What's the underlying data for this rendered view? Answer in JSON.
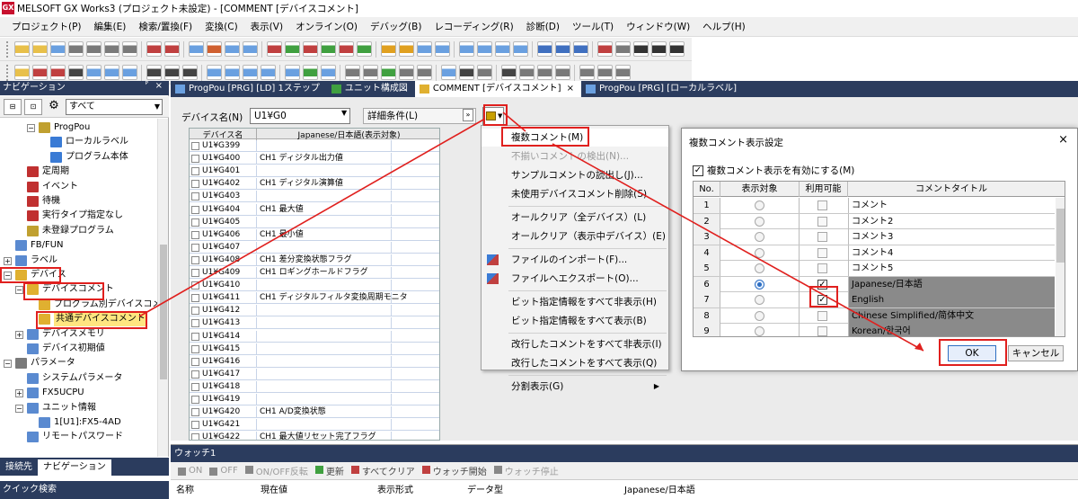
{
  "window": {
    "title": "MELSOFT GX Works3 (プロジェクト未設定) - [COMMENT [デバイスコメント]",
    "logo": "GX"
  },
  "menu": [
    "プロジェクト(P)",
    "編集(E)",
    "検索/置換(F)",
    "変換(C)",
    "表示(V)",
    "オンライン(O)",
    "デバッグ(B)",
    "レコーディング(R)",
    "診断(D)",
    "ツール(T)",
    "ウィンドウ(W)",
    "ヘルプ(H)"
  ],
  "nav": {
    "header": "ナビゲーション",
    "pin": "ᴾ",
    "close": "×",
    "filter": "すべて",
    "tree": [
      {
        "label": "ProgPou",
        "indent": 2,
        "toggle": "−",
        "icon": "#c0a030"
      },
      {
        "label": "ローカルラベル",
        "indent": 3,
        "toggle": "",
        "icon": "#3a7bd5"
      },
      {
        "label": "プログラム本体",
        "indent": 3,
        "toggle": "",
        "icon": "#3a7bd5"
      },
      {
        "label": "定周期",
        "indent": 1,
        "toggle": "",
        "icon": "#c03030"
      },
      {
        "label": "イベント",
        "indent": 1,
        "toggle": "",
        "icon": "#c03030"
      },
      {
        "label": "待機",
        "indent": 1,
        "toggle": "",
        "icon": "#c03030"
      },
      {
        "label": "実行タイプ指定なし",
        "indent": 1,
        "toggle": "",
        "icon": "#c03030"
      },
      {
        "label": "未登録プログラム",
        "indent": 1,
        "toggle": "",
        "icon": "#c0a030"
      },
      {
        "label": "FB/FUN",
        "indent": 0,
        "toggle": "",
        "icon": "#5a8ad0"
      },
      {
        "label": "ラベル",
        "indent": 0,
        "toggle": "+",
        "icon": "#5a8ad0"
      },
      {
        "label": "デバイス",
        "indent": 0,
        "toggle": "−",
        "icon": "#e0b030"
      },
      {
        "label": "デバイスコメント",
        "indent": 1,
        "toggle": "−",
        "icon": "#e0b030"
      },
      {
        "label": "プログラム別デバイスコメ",
        "indent": 2,
        "toggle": "",
        "icon": "#e0b030"
      },
      {
        "label": "共通デバイスコメント",
        "indent": 2,
        "toggle": "",
        "icon": "#e0b030",
        "selected": true
      },
      {
        "label": "デバイスメモリ",
        "indent": 1,
        "toggle": "+",
        "icon": "#5a8ad0"
      },
      {
        "label": "デバイス初期値",
        "indent": 1,
        "toggle": "",
        "icon": "#5a8ad0"
      },
      {
        "label": "パラメータ",
        "indent": 0,
        "toggle": "−",
        "icon": "#7a7a7a"
      },
      {
        "label": "システムパラメータ",
        "indent": 1,
        "toggle": "",
        "icon": "#5a8ad0"
      },
      {
        "label": "FX5UCPU",
        "indent": 1,
        "toggle": "+",
        "icon": "#5a8ad0"
      },
      {
        "label": "ユニット情報",
        "indent": 1,
        "toggle": "−",
        "icon": "#5a8ad0"
      },
      {
        "label": "1[U1]:FX5-4AD",
        "indent": 2,
        "toggle": "",
        "icon": "#5a8ad0"
      },
      {
        "label": "リモートパスワード",
        "indent": 1,
        "toggle": "",
        "icon": "#5a8ad0"
      }
    ],
    "bottom_tabs": [
      "接続先",
      "ナビゲーション"
    ],
    "quick_search": "クイック検索"
  },
  "doc_tabs": [
    {
      "label": "ProgPou [PRG] [LD] 1ステップ",
      "active": false
    },
    {
      "label": "ユニット構成図",
      "active": false
    },
    {
      "label": "COMMENT [デバイスコメント]",
      "active": true
    },
    {
      "label": "ProgPou [PRG] [ローカルラベル]",
      "active": false
    }
  ],
  "doc_tab_close": "×",
  "editor": {
    "device_label": "デバイス名(N)",
    "device_value": "U1¥G0",
    "detail": "詳細条件(L)",
    "grid_header": [
      "デバイス名",
      "Japanese/日本語(表示対象)"
    ],
    "rows": [
      [
        "U1¥G399",
        ""
      ],
      [
        "U1¥G400",
        "CH1 ディジタル出力値"
      ],
      [
        "U1¥G401",
        ""
      ],
      [
        "U1¥G402",
        "CH1 ディジタル演算値"
      ],
      [
        "U1¥G403",
        ""
      ],
      [
        "U1¥G404",
        "CH1 最大値"
      ],
      [
        "U1¥G405",
        ""
      ],
      [
        "U1¥G406",
        "CH1 最小値"
      ],
      [
        "U1¥G407",
        ""
      ],
      [
        "U1¥G408",
        "CH1 差分変換状態フラグ"
      ],
      [
        "U1¥G409",
        "CH1 ロギングホールドフラグ"
      ],
      [
        "U1¥G410",
        ""
      ],
      [
        "U1¥G411",
        "CH1 ディジタルフィルタ変換周期モニタ"
      ],
      [
        "U1¥G412",
        ""
      ],
      [
        "U1¥G413",
        ""
      ],
      [
        "U1¥G414",
        ""
      ],
      [
        "U1¥G415",
        ""
      ],
      [
        "U1¥G416",
        ""
      ],
      [
        "U1¥G417",
        ""
      ],
      [
        "U1¥G418",
        ""
      ],
      [
        "U1¥G419",
        ""
      ],
      [
        "U1¥G420",
        "CH1 A/D変換状態"
      ],
      [
        "U1¥G421",
        ""
      ],
      [
        "U1¥G422",
        "CH1 最大値リセット完了フラグ"
      ]
    ]
  },
  "context_menu": [
    {
      "label": "複数コメント(M)",
      "type": "item",
      "hl": true
    },
    {
      "label": "不揃いコメントの検出(N)...",
      "type": "disabled"
    },
    {
      "label": "サンプルコメントの読出し(J)...",
      "type": "item"
    },
    {
      "label": "未使用デバイスコメント削除(S)",
      "type": "item"
    },
    {
      "type": "sep"
    },
    {
      "label": "オールクリア（全デバイス）(L)",
      "type": "item"
    },
    {
      "label": "オールクリア（表示中デバイス）(E)",
      "type": "item"
    },
    {
      "type": "sep"
    },
    {
      "label": "ファイルのインポート(F)...",
      "type": "item",
      "icon": true
    },
    {
      "label": "ファイルへエクスポート(O)...",
      "type": "item",
      "icon": true
    },
    {
      "type": "sep"
    },
    {
      "label": "ビット指定情報をすべて非表示(H)",
      "type": "item"
    },
    {
      "label": "ビット指定情報をすべて表示(B)",
      "type": "item"
    },
    {
      "type": "sep"
    },
    {
      "label": "改行したコメントをすべて非表示(I)",
      "type": "item"
    },
    {
      "label": "改行したコメントをすべて表示(Q)",
      "type": "item"
    },
    {
      "type": "sep"
    },
    {
      "label": "分割表示(G)",
      "type": "submenu"
    }
  ],
  "submenu_arrow": "▶",
  "watch": {
    "title": "ウォッチ1",
    "buttons": [
      {
        "label": "ON",
        "dim": true
      },
      {
        "label": "OFF",
        "dim": true
      },
      {
        "label": "ON/OFF反転",
        "dim": true
      },
      {
        "label": "更新",
        "dim": false
      },
      {
        "label": "すべてクリア",
        "dim": false
      },
      {
        "label": "ウォッチ開始",
        "dim": false
      },
      {
        "label": "ウォッチ停止",
        "dim": true
      }
    ],
    "columns": [
      "名称",
      "現在値",
      "表示形式",
      "データ型",
      "Japanese/日本語"
    ]
  },
  "dialog": {
    "title": "複数コメント表示設定",
    "close": "×",
    "enable_label": "複数コメント表示を有効にする(M)",
    "check_mark": "✓",
    "columns": [
      "No.",
      "表示対象",
      "利用可能",
      "コメントタイトル"
    ],
    "rows": [
      {
        "no": "1",
        "title": "コメント",
        "radio": false,
        "check": false,
        "shade": false
      },
      {
        "no": "2",
        "title": "コメント2",
        "radio": false,
        "check": false,
        "shade": false
      },
      {
        "no": "3",
        "title": "コメント3",
        "radio": false,
        "check": false,
        "shade": false
      },
      {
        "no": "4",
        "title": "コメント4",
        "radio": false,
        "check": false,
        "shade": false
      },
      {
        "no": "5",
        "title": "コメント5",
        "radio": false,
        "check": false,
        "shade": false
      },
      {
        "no": "6",
        "title": "Japanese/日本語",
        "radio": true,
        "check": true,
        "shade": true
      },
      {
        "no": "7",
        "title": "English",
        "radio": false,
        "check": true,
        "shade": true
      },
      {
        "no": "8",
        "title": "Chinese Simplified/简体中文",
        "radio": false,
        "check": false,
        "shade": true
      },
      {
        "no": "9",
        "title": "Korean/한국어",
        "radio": false,
        "check": false,
        "shade": true
      }
    ],
    "ok": "OK",
    "cancel": "キャンセル"
  },
  "colors": {
    "accent_red": "#e0201e",
    "panel_navy": "#2b3c5e",
    "selection_yellow": "#ffe680"
  }
}
